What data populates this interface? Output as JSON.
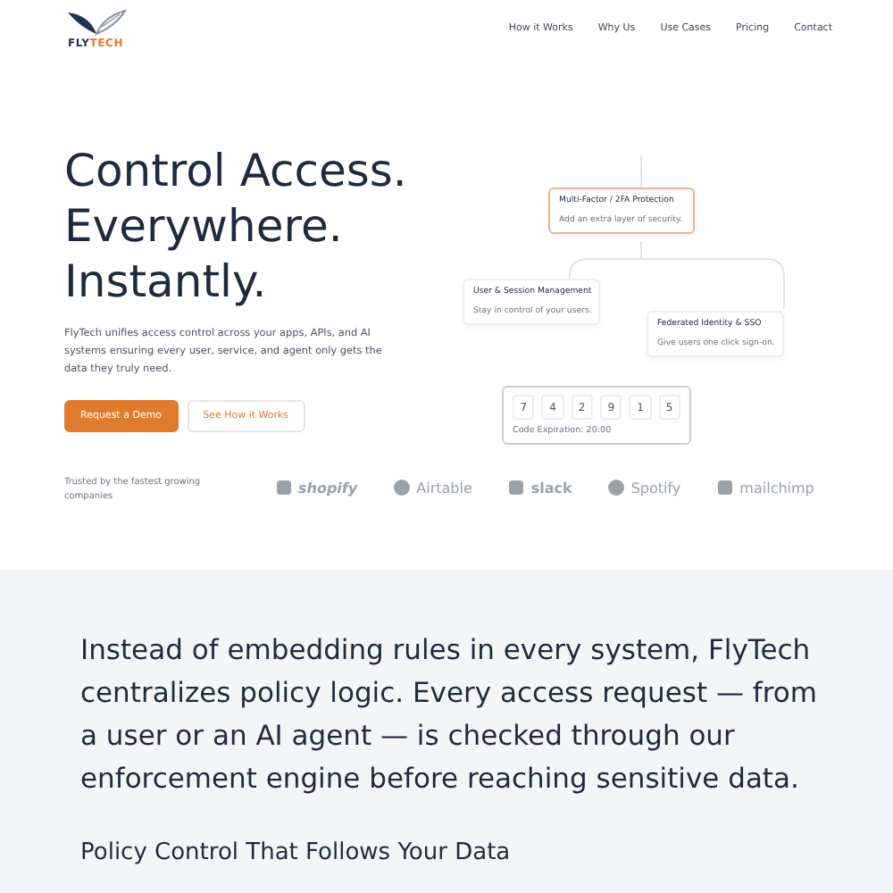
{
  "logo": {
    "brand_first": "FLY",
    "brand_second": "TECH"
  },
  "nav": [
    "How it Works",
    "Why Us",
    "Use Cases",
    "Pricing",
    "Contact"
  ],
  "hero": {
    "headline": [
      "Control Access.",
      "Everywhere.",
      "Instantly."
    ],
    "description": "FlyTech unifies access control across your apps, APIs, and AI systems ensuring every user, service, and agent only gets the data they truly need.",
    "buttons": [
      {
        "label": "Request a Demo",
        "kind": "primary"
      },
      {
        "label": "See How it Works",
        "kind": "secondary"
      }
    ]
  },
  "diagram": {
    "cards": [
      {
        "title": "Multi-Factor / 2FA Protection",
        "subtitle": "Add an extra layer of security.",
        "highlighted": true
      },
      {
        "title": "User & Session Management",
        "subtitle": "Stay in control of your users.",
        "highlighted": false
      },
      {
        "title": "Federated Identity & SSO",
        "subtitle": "Give users one click sign-on.",
        "highlighted": false
      }
    ],
    "code_digits": [
      "7",
      "4",
      "2",
      "9",
      "1",
      "5"
    ],
    "code_expiration": "Code Expiration: 20:00"
  },
  "trusted": {
    "label": "Trusted by the fastest growing companies",
    "companies": [
      "shopify",
      "Airtable",
      "slack",
      "Spotify",
      "mailchimp"
    ]
  },
  "statement": "Instead of embedding rules in every system, FlyTech centralizes  policy logic. Every access request — from a user or an AI agent — is  checked through our enforcement engine before reaching sensitive data.",
  "section_title": "Policy Control That Follows Your Data"
}
